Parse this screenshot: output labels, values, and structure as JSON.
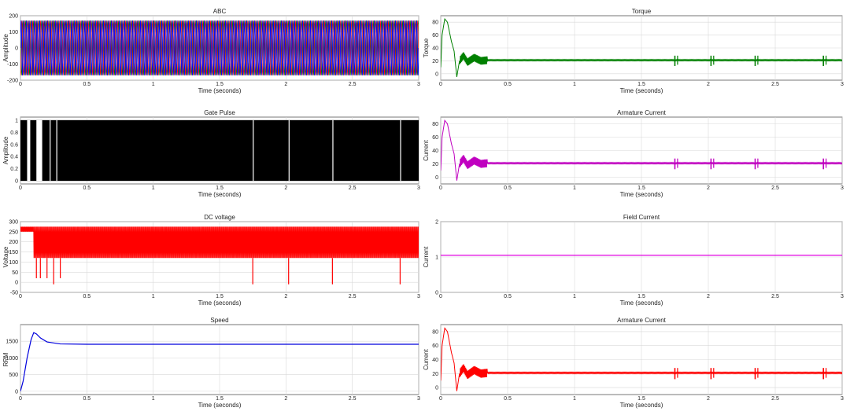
{
  "figure": {
    "plots": [
      {
        "title": "ABC",
        "xlabel": "Time (seconds)",
        "ylabel": "Amplitude",
        "color": "#0000ff"
      },
      {
        "title": "Torque",
        "xlabel": "Time (seconds)",
        "ylabel": "Torque",
        "color": "#008000"
      },
      {
        "title": "Gate Pulse",
        "xlabel": "Time (seconds)",
        "ylabel": "Amplitude",
        "color": "#000000"
      },
      {
        "title": "Armature Current",
        "xlabel": "Time (seconds)",
        "ylabel": "Current",
        "color": "#c000c0"
      },
      {
        "title": "DC voltage",
        "xlabel": "Time (seconds)",
        "ylabel": "Voltage",
        "color": "#ff0000"
      },
      {
        "title": "Field Current",
        "xlabel": "Time (seconds)",
        "ylabel": "Current",
        "color": "#e000e0"
      },
      {
        "title": "Speed",
        "xlabel": "Time (seconds)",
        "ylabel": "RPM",
        "color": "#0000dd"
      },
      {
        "title": "Armature Current",
        "xlabel": "Time (seconds)",
        "ylabel": "Current",
        "color": "#ff0000"
      }
    ]
  },
  "chart_data": [
    {
      "type": "line",
      "title": "ABC",
      "xlabel": "Time (seconds)",
      "ylabel": "Amplitude",
      "xlim": [
        0,
        3
      ],
      "ylim": [
        -200,
        200
      ],
      "xticks": [
        0,
        0.5,
        1,
        1.5,
        2,
        2.5,
        3
      ],
      "xtick_labels": [
        "0",
        "0.5",
        "1",
        "1.5",
        "2",
        "2.5",
        "3"
      ],
      "yticks": [
        -200,
        -100,
        0,
        100,
        200
      ],
      "ytick_labels": [
        "-200",
        "-100",
        "0",
        "100",
        "200"
      ],
      "grid": true,
      "series": [
        {
          "color": "#0000ff",
          "signal": "sinusoidal three-phase, amplitude ~170",
          "x": [
            0,
            0.5,
            1,
            1.5,
            2,
            2.5,
            3
          ],
          "y": [
            170,
            -170,
            170,
            -170,
            170,
            -170,
            170
          ]
        }
      ]
    },
    {
      "type": "line",
      "title": "Torque",
      "xlabel": "Time (seconds)",
      "ylabel": "Torque",
      "xlim": [
        0,
        3
      ],
      "ylim": [
        -10,
        90
      ],
      "xticks": [
        0,
        0.5,
        1,
        1.5,
        2,
        2.5,
        3
      ],
      "xtick_labels": [
        "0",
        "0.5",
        "1",
        "1.5",
        "2",
        "2.5",
        "3"
      ],
      "yticks": [
        0,
        20,
        40,
        60,
        80
      ],
      "ytick_labels": [
        "0",
        "20",
        "40",
        "60",
        "80"
      ],
      "grid": true,
      "series": [
        {
          "color": "#008000",
          "x": [
            0,
            0.01,
            0.03,
            0.05,
            0.08,
            0.1,
            0.12,
            0.14,
            0.17,
            0.2,
            0.25,
            0.3,
            0.35,
            1.75,
            2.0,
            2.35,
            2.85,
            3
          ],
          "y": [
            10,
            60,
            85,
            80,
            50,
            35,
            -5,
            20,
            28,
            18,
            25,
            20,
            21,
            21,
            21,
            21,
            21,
            21
          ]
        }
      ]
    },
    {
      "type": "area",
      "title": "Gate Pulse",
      "xlabel": "Time (seconds)",
      "ylabel": "Amplitude",
      "xlim": [
        0,
        3
      ],
      "ylim": [
        -0.05,
        1.05
      ],
      "xticks": [
        0,
        0.5,
        1,
        1.5,
        2,
        2.5,
        3
      ],
      "xtick_labels": [
        "0",
        "0.5",
        "1",
        "1.5",
        "2",
        "2.5",
        "3"
      ],
      "yticks": [
        0,
        0.2,
        0.4,
        0.6,
        0.8,
        1
      ],
      "ytick_labels": [
        "0",
        "0.2",
        "0.4",
        "0.6",
        "0.8",
        "1"
      ],
      "grid": true,
      "series": [
        {
          "color": "#000000",
          "signal": "high-frequency 0/1 pulse train",
          "x": [
            0,
            3
          ],
          "y": [
            1,
            1
          ],
          "gaps": [
            0.05,
            0.12,
            0.14,
            0.22,
            0.27,
            1.75,
            2.02,
            2.35,
            2.86
          ]
        }
      ]
    },
    {
      "type": "line",
      "title": "Armature Current",
      "xlabel": "Time (seconds)",
      "ylabel": "Current",
      "xlim": [
        0,
        3
      ],
      "ylim": [
        -10,
        90
      ],
      "xticks": [
        0,
        0.5,
        1,
        1.5,
        2,
        2.5,
        3
      ],
      "xtick_labels": [
        "0",
        "0.5",
        "1",
        "1.5",
        "2",
        "2.5",
        "3"
      ],
      "yticks": [
        0,
        20,
        40,
        60,
        80
      ],
      "ytick_labels": [
        "0",
        "20",
        "40",
        "60",
        "80"
      ],
      "grid": true,
      "series": [
        {
          "color": "#c000c0",
          "x": [
            0,
            0.01,
            0.03,
            0.05,
            0.08,
            0.1,
            0.12,
            0.14,
            0.17,
            0.2,
            0.25,
            0.3,
            0.35,
            1.75,
            2.0,
            2.35,
            2.85,
            3
          ],
          "y": [
            10,
            60,
            85,
            80,
            50,
            35,
            -5,
            20,
            28,
            18,
            25,
            20,
            21,
            21,
            21,
            21,
            21,
            21
          ]
        }
      ]
    },
    {
      "type": "line",
      "title": "DC voltage",
      "xlabel": "Time (seconds)",
      "ylabel": "Voltage",
      "xlim": [
        0,
        3
      ],
      "ylim": [
        -50,
        300
      ],
      "xticks": [
        0,
        0.5,
        1,
        1.5,
        2,
        2.5,
        3
      ],
      "xtick_labels": [
        "0",
        "0.5",
        "1",
        "1.5",
        "2",
        "2.5",
        "3"
      ],
      "yticks": [
        -50,
        0,
        50,
        100,
        150,
        200,
        250,
        300
      ],
      "ytick_labels": [
        "-50",
        "0",
        "50",
        "100",
        "150",
        "200",
        "250",
        "300"
      ],
      "grid": true,
      "series": [
        {
          "color": "#ff0000",
          "signal": "switching between ~120 and ~275",
          "x": [
            0,
            0.1,
            0.12,
            0.15,
            0.2,
            0.25,
            0.3,
            0.35,
            1.75,
            2.02,
            2.35,
            2.86,
            3
          ],
          "y": [
            275,
            275,
            100,
            20,
            30,
            -10,
            0,
            275,
            0,
            -10,
            -10,
            -10,
            275
          ]
        }
      ]
    },
    {
      "type": "line",
      "title": "Field Current",
      "xlabel": "Time (seconds)",
      "ylabel": "Current",
      "xlim": [
        0,
        3
      ],
      "ylim": [
        0,
        2
      ],
      "xticks": [
        0,
        0.5,
        1,
        1.5,
        2,
        2.5,
        3
      ],
      "xtick_labels": [
        "0",
        "0.5",
        "1",
        "1.5",
        "2",
        "2.5",
        "3"
      ],
      "yticks": [
        0,
        1,
        2
      ],
      "ytick_labels": [
        "0",
        "1",
        "2"
      ],
      "grid": true,
      "series": [
        {
          "color": "#e000e0",
          "x": [
            0,
            3
          ],
          "y": [
            1.05,
            1.05
          ]
        }
      ]
    },
    {
      "type": "line",
      "title": "Speed",
      "xlabel": "Time (seconds)",
      "ylabel": "RPM",
      "xlim": [
        0,
        3
      ],
      "ylim": [
        -100,
        2000
      ],
      "xticks": [
        0,
        0.5,
        1,
        1.5,
        2,
        2.5,
        3
      ],
      "xtick_labels": [
        "0",
        "0.5",
        "1",
        "1.5",
        "2",
        "2.5",
        "3"
      ],
      "yticks": [
        0,
        500,
        1000,
        1500
      ],
      "ytick_labels": [
        "0",
        "500",
        "1000",
        "1500"
      ],
      "grid": true,
      "series": [
        {
          "color": "#0000dd",
          "x": [
            0,
            0.02,
            0.05,
            0.08,
            0.1,
            0.12,
            0.15,
            0.2,
            0.3,
            0.5,
            1,
            1.5,
            2,
            2.5,
            3
          ],
          "y": [
            0,
            300,
            1000,
            1550,
            1760,
            1720,
            1600,
            1480,
            1420,
            1410,
            1410,
            1410,
            1410,
            1410,
            1410
          ]
        }
      ]
    },
    {
      "type": "line",
      "title": "Armature Current",
      "xlabel": "Time (seconds)",
      "ylabel": "Current",
      "xlim": [
        0,
        3
      ],
      "ylim": [
        -10,
        90
      ],
      "xticks": [
        0,
        0.5,
        1,
        1.5,
        2,
        2.5,
        3
      ],
      "xtick_labels": [
        "0",
        "0.5",
        "1",
        "1.5",
        "2",
        "2.5",
        "3"
      ],
      "yticks": [
        0,
        20,
        40,
        60,
        80
      ],
      "ytick_labels": [
        "0",
        "20",
        "40",
        "60",
        "80"
      ],
      "grid": true,
      "series": [
        {
          "color": "#ff0000",
          "x": [
            0,
            0.01,
            0.03,
            0.05,
            0.08,
            0.1,
            0.12,
            0.14,
            0.17,
            0.2,
            0.25,
            0.3,
            0.35,
            1.75,
            2.0,
            2.35,
            2.85,
            3
          ],
          "y": [
            10,
            60,
            85,
            80,
            50,
            35,
            -5,
            20,
            28,
            18,
            25,
            20,
            21,
            21,
            21,
            21,
            21,
            21
          ]
        }
      ]
    }
  ]
}
